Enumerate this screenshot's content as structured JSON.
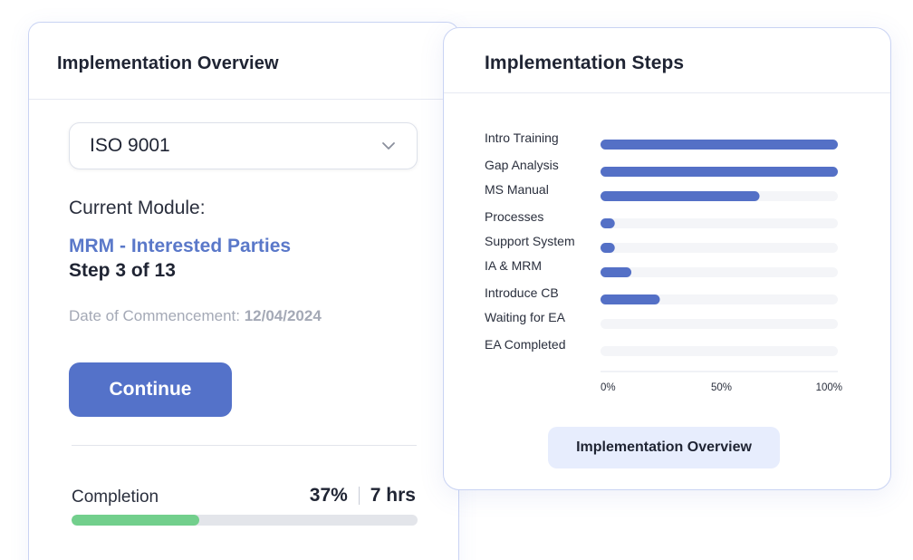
{
  "overview_card": {
    "title": "Implementation Overview",
    "standard_select": {
      "value": "ISO 9001"
    },
    "current_module_label": "Current Module:",
    "module_name": "MRM - Interested Parties",
    "step_text": "Step 3 of 13",
    "date_label": "Date of Commencement:",
    "date_value": "12/04/2024",
    "continue_label": "Continue",
    "completion": {
      "label": "Completion",
      "percent_text": "37%",
      "hours_text": "7 hrs",
      "progress_fraction": 0.37
    }
  },
  "steps_card": {
    "title": "Implementation Steps",
    "overview_button_label": "Implementation Overview"
  },
  "colors": {
    "accent": "#5472c9",
    "module_link": "#5a78c9",
    "bar": "#5470c6",
    "bar_track": "#f4f5f8",
    "progress_green": "#72cf8c",
    "card_border": "#c9d3f3"
  },
  "icons": {
    "select_chevron": "chevron-down-icon"
  },
  "chart_data": {
    "type": "bar",
    "orientation": "horizontal",
    "categories": [
      "Intro Training",
      "Gap Analysis",
      "MS Manual",
      "Processes",
      "Support System",
      "IA & MRM",
      "Introduce CB",
      "Waiting for EA",
      "EA Completed"
    ],
    "values": [
      100,
      100,
      67,
      6,
      6,
      13,
      25,
      0,
      0
    ],
    "x_ticks": [
      "0%",
      "50%",
      "100%"
    ],
    "xlim": [
      0,
      100
    ],
    "grid": false,
    "legend": "none"
  }
}
